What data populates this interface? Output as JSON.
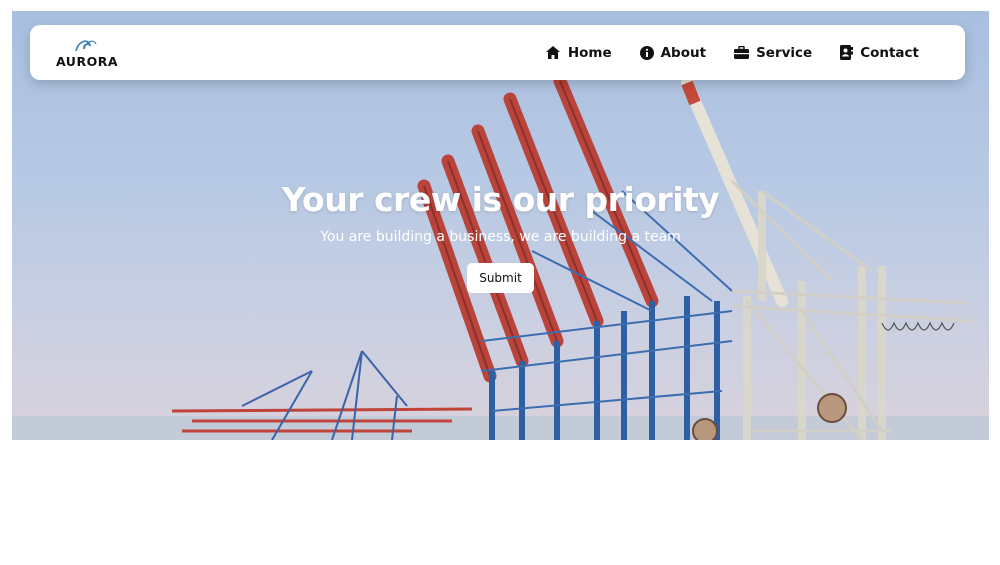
{
  "brand": {
    "name": "AURORA",
    "logo_icon": "wave-logo-icon",
    "accent": "#3b7fb8"
  },
  "nav": {
    "items": [
      {
        "label": "Home",
        "icon": "home-icon"
      },
      {
        "label": "About",
        "icon": "info-icon"
      },
      {
        "label": "Service",
        "icon": "briefcase-icon"
      },
      {
        "label": "Contact",
        "icon": "contact-book-icon"
      }
    ]
  },
  "hero": {
    "headline": "Your crew is our priority",
    "subheadline": "You are building a business, we are building a team",
    "cta_label": "Submit",
    "image": "container port cranes"
  }
}
